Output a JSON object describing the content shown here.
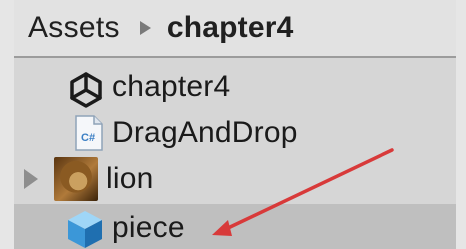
{
  "breadcrumb": {
    "root": "Assets",
    "current": "chapter4"
  },
  "items": [
    {
      "label": "chapter4",
      "icon": "unity-scene-icon"
    },
    {
      "label": "DragAndDrop",
      "icon": "csharp-script-icon",
      "icon_text": "C#"
    },
    {
      "label": "lion",
      "icon": "lion-texture-thumbnail",
      "expandable": true
    },
    {
      "label": "piece",
      "icon": "prefab-cube-icon",
      "selected": true
    }
  ],
  "annotation": {
    "color": "#d83a3a",
    "points_to": "piece"
  }
}
